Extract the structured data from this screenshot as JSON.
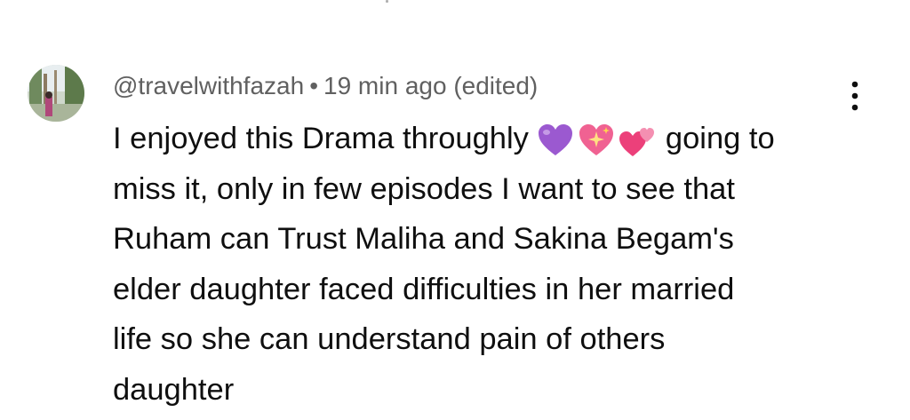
{
  "comment": {
    "username": "@travelwithfazah",
    "separator": "•",
    "time": "19 min ago (edited)",
    "text_lines": [
      "I enjoyed this Drama throughly",
      "going to",
      "miss it,  only in few episodes I want to see that",
      "Ruham can Trust Maliha and Sakina Begam's",
      "elder daughter faced difficulties in her married",
      "life so she can understand pain of others",
      "daughter"
    ],
    "emojis": [
      "purple-heart-icon",
      "sparkling-heart-icon",
      "two-hearts-icon"
    ]
  },
  "colors": {
    "meta_text": "#606060",
    "body_text": "#0f0f0f",
    "purple_heart": "#9b59d0",
    "pink_heart": "#f06292"
  }
}
